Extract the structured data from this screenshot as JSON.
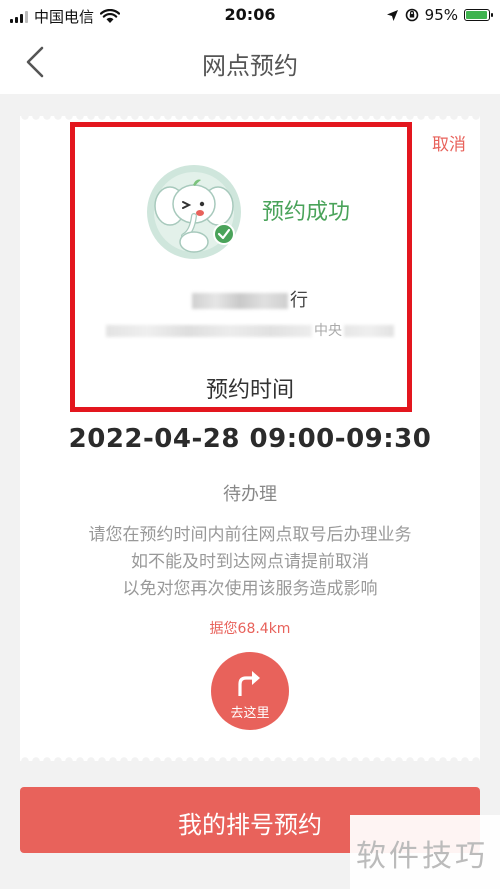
{
  "status_bar": {
    "carrier": "中国电信",
    "time": "20:06",
    "battery": "95%",
    "battery_level": 0.95
  },
  "header": {
    "title": "网点预约"
  },
  "card": {
    "cancel_label": "取消",
    "success_text": "预约成功",
    "bank_name_suffix": "行",
    "address_fragment": "中央",
    "time_label": "预约时间",
    "datetime": "2022-04-28 09:00-09:30",
    "status": "待办理",
    "notes": [
      "请您在预约时间内前往网点取号后办理业务",
      "如不能及时到达网点请提前取消",
      "以免对您再次使用该服务造成影响"
    ],
    "distance": "据您68.4km",
    "goto_label": "去这里"
  },
  "main_button": {
    "label": "我的排号预约"
  },
  "watermark": {
    "text": "软件技巧"
  },
  "colors": {
    "accent": "#e8625b",
    "success": "#4aa35a",
    "highlight_border": "#e3161e"
  }
}
